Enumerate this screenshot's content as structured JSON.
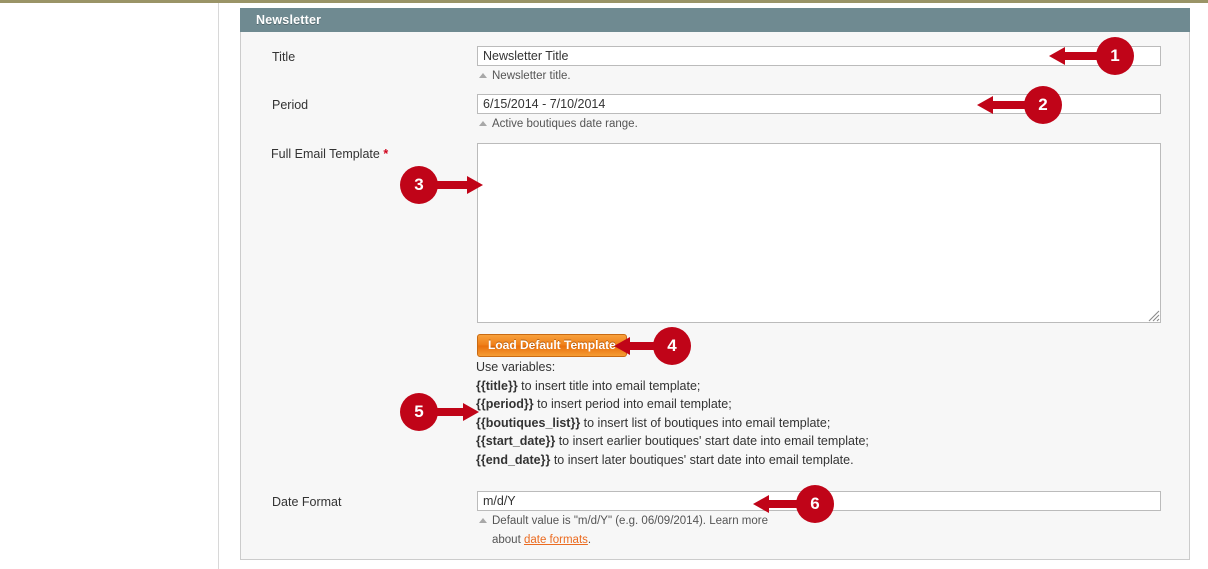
{
  "panel": {
    "title": "Newsletter"
  },
  "fields": {
    "title": {
      "label": "Title",
      "value": "Newsletter Title",
      "placeholder": "",
      "hint": "Newsletter title."
    },
    "period": {
      "label": "Period",
      "value": "6/15/2014 - 7/10/2014",
      "placeholder": "",
      "hint": "Active boutiques date range."
    },
    "template": {
      "label": "Full Email Template",
      "required_mark": "*",
      "value": "",
      "placeholder": ""
    },
    "date_format": {
      "label": "Date Format",
      "value": "m/d/Y",
      "placeholder": "",
      "hint_line1": "Default value is \"m/d/Y\" (e.g. 06/09/2014). Learn more",
      "hint_line2_prefix": "about ",
      "hint_link": "date formats",
      "hint_line2_suffix": "."
    }
  },
  "buttons": {
    "load_default_template": "Load Default Template"
  },
  "variables": {
    "heading": "Use variables:",
    "items": [
      {
        "token": "{{title}}",
        "text": " to insert title into email template;"
      },
      {
        "token": "{{period}}",
        "text": " to insert period into email template;"
      },
      {
        "token": "{{boutiques_list}}",
        "text": " to insert list of boutiques into email template;"
      },
      {
        "token": "{{start_date}}",
        "text": " to insert earlier boutiques' start date into email template;"
      },
      {
        "token": "{{end_date}}",
        "text": " to insert later boutiques' start date into email template."
      }
    ]
  },
  "annotations": [
    {
      "number": "1",
      "target": "title-input",
      "direction": "left"
    },
    {
      "number": "2",
      "target": "period-input",
      "direction": "left"
    },
    {
      "number": "3",
      "target": "template-textarea",
      "direction": "right"
    },
    {
      "number": "4",
      "target": "load-default-template-button",
      "direction": "left"
    },
    {
      "number": "5",
      "target": "variables-list",
      "direction": "right"
    },
    {
      "number": "6",
      "target": "date-format-input",
      "direction": "left"
    }
  ],
  "colors": {
    "panel_header": "#6f8a91",
    "panel_body": "#f7f7f7",
    "marker_red": "#c00418",
    "button_orange": "#ef7e18",
    "link_orange": "#eb6b20",
    "top_rule": "#9a9467",
    "required_star": "#d0021b"
  }
}
